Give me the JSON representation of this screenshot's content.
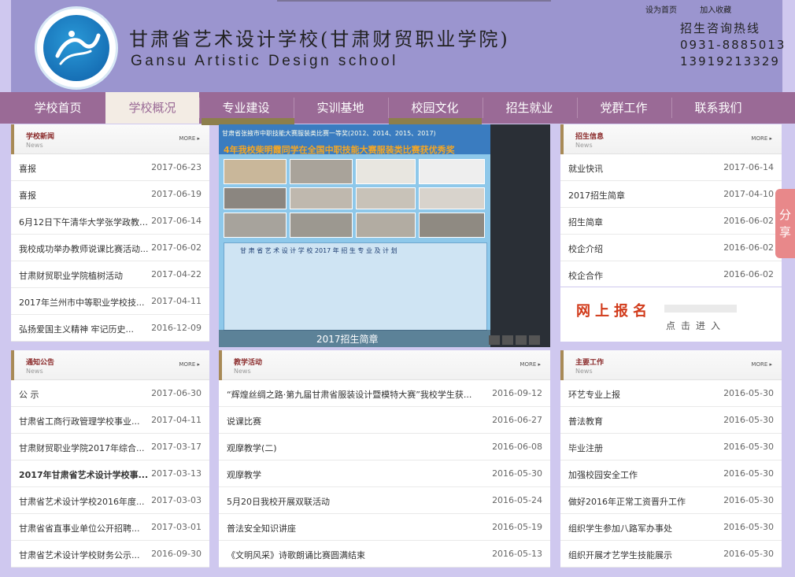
{
  "header": {
    "title_cn": "甘肃省艺术设计学校(甘肃财贸职业学院)",
    "title_en": "Gansu Artistic Design school",
    "top_links": [
      "设为首页",
      "加入收藏"
    ],
    "hotline_label": "招生咨询热线",
    "hotline_phone1": "0931-8885013",
    "hotline_phone2": "13919213329"
  },
  "nav": {
    "items": [
      "学校首页",
      "学校概况",
      "专业建设",
      "实训基地",
      "校园文化",
      "招生就业",
      "党群工作",
      "联系我们"
    ],
    "active": "学校概况"
  },
  "panels": {
    "news": {
      "title": "学校新闻",
      "subtitle": "News",
      "more": "MORE ▸",
      "rows": [
        {
          "text": "喜报",
          "date": "2017-06-23"
        },
        {
          "text": "喜报",
          "date": "2017-06-19"
        },
        {
          "text": "6月12日下午清华大学张学政教授...",
          "date": "2017-06-14"
        },
        {
          "text": "我校成功举办教师说课比赛活动...",
          "date": "2017-06-02"
        },
        {
          "text": "甘肃财贸职业学院植树活动",
          "date": "2017-04-22"
        },
        {
          "text": "2017年兰州市中等职业学校技...",
          "date": "2017-04-11"
        },
        {
          "text": "弘扬爱国主义精神 牢记历史...",
          "date": "2016-12-09"
        }
      ]
    },
    "enroll": {
      "title": "招生信息",
      "subtitle": "News",
      "more": "MORE ▸",
      "rows": [
        {
          "text": "就业快讯",
          "date": "2017-06-14"
        },
        {
          "text": "2017招生简章",
          "date": "2017-04-10"
        },
        {
          "text": "招生简章",
          "date": "2016-06-02"
        },
        {
          "text": "校企介绍",
          "date": "2016-06-02"
        },
        {
          "text": "校企合作",
          "date": "2016-06-02"
        }
      ]
    },
    "notice": {
      "title": "通知公告",
      "subtitle": "News",
      "more": "MORE ▸",
      "rows": [
        {
          "text": "公 示",
          "date": "2017-06-30",
          "bold": false
        },
        {
          "text": "甘肃省工商行政管理学校事业...",
          "date": "2017-04-11",
          "bold": false
        },
        {
          "text": "甘肃财贸职业学院2017年综合...",
          "date": "2017-03-17",
          "bold": false
        },
        {
          "text": "2017年甘肃省艺术设计学校事...",
          "date": "2017-03-13",
          "bold": true
        },
        {
          "text": "甘肃省艺术设计学校2016年度...",
          "date": "2017-03-03",
          "bold": false
        },
        {
          "text": "甘肃省省直事业单位公开招聘...",
          "date": "2017-03-01",
          "bold": false
        },
        {
          "text": "甘肃省艺术设计学校财务公示...",
          "date": "2016-09-30",
          "bold": false
        }
      ]
    },
    "teaching": {
      "title": "教学活动",
      "subtitle": "News",
      "more": "MORE ▸",
      "rows": [
        {
          "text": "“辉煌丝绸之路·第九届甘肃省服装设计暨模特大赛”我校学生获...",
          "date": "2016-09-12"
        },
        {
          "text": "说课比赛",
          "date": "2016-06-27"
        },
        {
          "text": "观摩教学(二)",
          "date": "2016-06-08"
        },
        {
          "text": "观摩教学",
          "date": "2016-05-30"
        },
        {
          "text": "5月20日我校开展双联活动",
          "date": "2016-05-24"
        },
        {
          "text": "普法安全知识讲座",
          "date": "2016-05-19"
        },
        {
          "text": "《文明风采》诗歌朗诵比赛圆满结束",
          "date": "2016-05-13"
        }
      ]
    },
    "main_work": {
      "title": "主要工作",
      "subtitle": "News",
      "more": "MORE ▸",
      "rows": [
        {
          "text": "环艺专业上报",
          "date": "2016-05-30"
        },
        {
          "text": "普法教育",
          "date": "2016-05-30"
        },
        {
          "text": "毕业注册",
          "date": "2016-05-30"
        },
        {
          "text": "加强校园安全工作",
          "date": "2016-05-30"
        },
        {
          "text": "做好2016年正常工资晋升工作",
          "date": "2016-05-30"
        },
        {
          "text": "组织学生参加八路军办事处",
          "date": "2016-05-30"
        },
        {
          "text": "组织开展才艺学生技能展示",
          "date": "2016-05-30"
        }
      ]
    }
  },
  "slider": {
    "caption": "2017招生简章",
    "headline": "4年我校柴明霞同学在全国中职技能大赛服装类比赛获优秀奖",
    "top_small": "甘肃省张掖市中职技能大赛服装类比赛一等奖(2012、2014、2015、2017)",
    "table_title": "甘 肃 省 艺 术 设 计 学 校 2017 年 招 生 专 业 及 计 划"
  },
  "enroll_banner": {
    "big": "网上报名",
    "small": "点击进入"
  },
  "share": {
    "label1": "分",
    "label2": "享"
  },
  "colors": {
    "nav": "#9a6a96",
    "header": "#9b95cf",
    "background": "#cfc8ef",
    "accent_bar": "#a88a56"
  }
}
